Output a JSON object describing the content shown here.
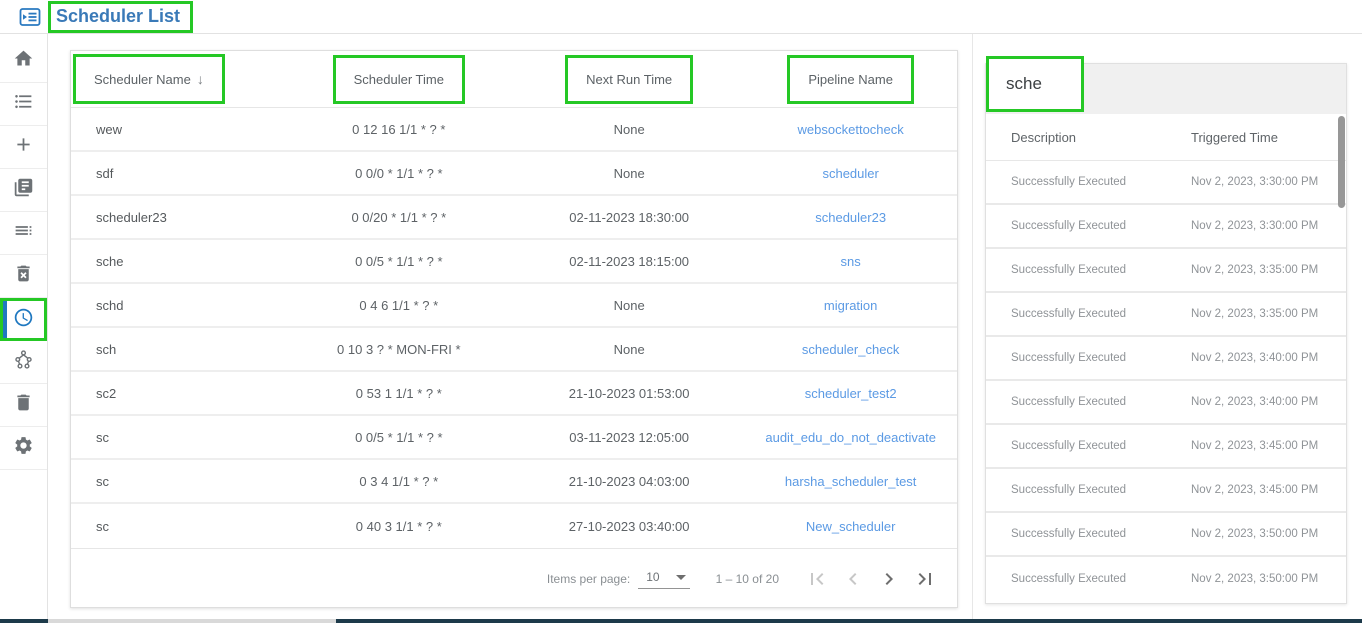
{
  "header": {
    "title": "Scheduler List",
    "menu_icon": "menu-open-icon"
  },
  "sidebar": {
    "items": [
      {
        "icon": "home-icon",
        "active": false
      },
      {
        "icon": "list-icon",
        "active": false
      },
      {
        "icon": "plus-icon",
        "active": false
      },
      {
        "icon": "library-icon",
        "active": false
      },
      {
        "icon": "dense-list-icon",
        "active": false
      },
      {
        "icon": "trash-x-icon",
        "active": false
      },
      {
        "icon": "clock-icon",
        "active": true
      },
      {
        "icon": "cluster-icon",
        "active": false
      },
      {
        "icon": "trash-icon",
        "active": false
      },
      {
        "icon": "gear-icon",
        "active": false
      }
    ]
  },
  "scheduler_table": {
    "columns": [
      "Scheduler Name",
      "Scheduler Time",
      "Next Run Time",
      "Pipeline Name"
    ],
    "sort_arrow": "↓",
    "rows": [
      {
        "name": "wew",
        "time": "0 12 16 1/1 * ? *",
        "next_run": "None",
        "pipeline": "websockettocheck"
      },
      {
        "name": "sdf",
        "time": "0 0/0 * 1/1 * ? *",
        "next_run": "None",
        "pipeline": "scheduler"
      },
      {
        "name": "scheduler23",
        "time": "0 0/20 * 1/1 * ? *",
        "next_run": "02-11-2023 18:30:00",
        "pipeline": "scheduler23"
      },
      {
        "name": "sche",
        "time": "0 0/5 * 1/1 * ? *",
        "next_run": "02-11-2023 18:15:00",
        "pipeline": "sns"
      },
      {
        "name": "schd",
        "time": "0 4 6 1/1 * ? *",
        "next_run": "None",
        "pipeline": "migration"
      },
      {
        "name": "sch",
        "time": "0 10 3 ? * MON-FRI *",
        "next_run": "None",
        "pipeline": "scheduler_check"
      },
      {
        "name": "sc2",
        "time": "0 53 1 1/1 * ? *",
        "next_run": "21-10-2023 01:53:00",
        "pipeline": "scheduler_test2"
      },
      {
        "name": "sc",
        "time": "0 0/5 * 1/1 * ? *",
        "next_run": "03-11-2023 12:05:00",
        "pipeline": "audit_edu_do_not_deactivate"
      },
      {
        "name": "sc",
        "time": "0 3 4 1/1 * ? *",
        "next_run": "21-10-2023 04:03:00",
        "pipeline": "harsha_scheduler_test"
      },
      {
        "name": "sc",
        "time": "0 40 3 1/1 * ? *",
        "next_run": "27-10-2023 03:40:00",
        "pipeline": "New_scheduler"
      }
    ],
    "paginator": {
      "items_per_page_label": "Items per page:",
      "items_per_page_value": "10",
      "range_label": "1 – 10 of 20",
      "nav_icons": [
        "first-page-icon",
        "prev-page-icon",
        "next-page-icon",
        "last-page-icon"
      ]
    }
  },
  "detail_panel": {
    "title": "sche",
    "columns": [
      "Description",
      "Triggered Time"
    ],
    "rows": [
      {
        "description": "Successfully Executed",
        "triggered_time": "Nov 2, 2023, 3:30:00 PM"
      },
      {
        "description": "Successfully Executed",
        "triggered_time": "Nov 2, 2023, 3:30:00 PM"
      },
      {
        "description": "Successfully Executed",
        "triggered_time": "Nov 2, 2023, 3:35:00 PM"
      },
      {
        "description": "Successfully Executed",
        "triggered_time": "Nov 2, 2023, 3:35:00 PM"
      },
      {
        "description": "Successfully Executed",
        "triggered_time": "Nov 2, 2023, 3:40:00 PM"
      },
      {
        "description": "Successfully Executed",
        "triggered_time": "Nov 2, 2023, 3:40:00 PM"
      },
      {
        "description": "Successfully Executed",
        "triggered_time": "Nov 2, 2023, 3:45:00 PM"
      },
      {
        "description": "Successfully Executed",
        "triggered_time": "Nov 2, 2023, 3:45:00 PM"
      },
      {
        "description": "Successfully Executed",
        "triggered_time": "Nov 2, 2023, 3:50:00 PM"
      },
      {
        "description": "Successfully Executed",
        "triggered_time": "Nov 2, 2023, 3:50:00 PM"
      }
    ]
  },
  "colors": {
    "annotation_green": "#25c825",
    "title_blue": "#3a7ab8",
    "link_blue": "#5b9ae4",
    "active_icon_blue": "#1f78c0",
    "bottom_bar_dark": "#1d3a4a"
  }
}
